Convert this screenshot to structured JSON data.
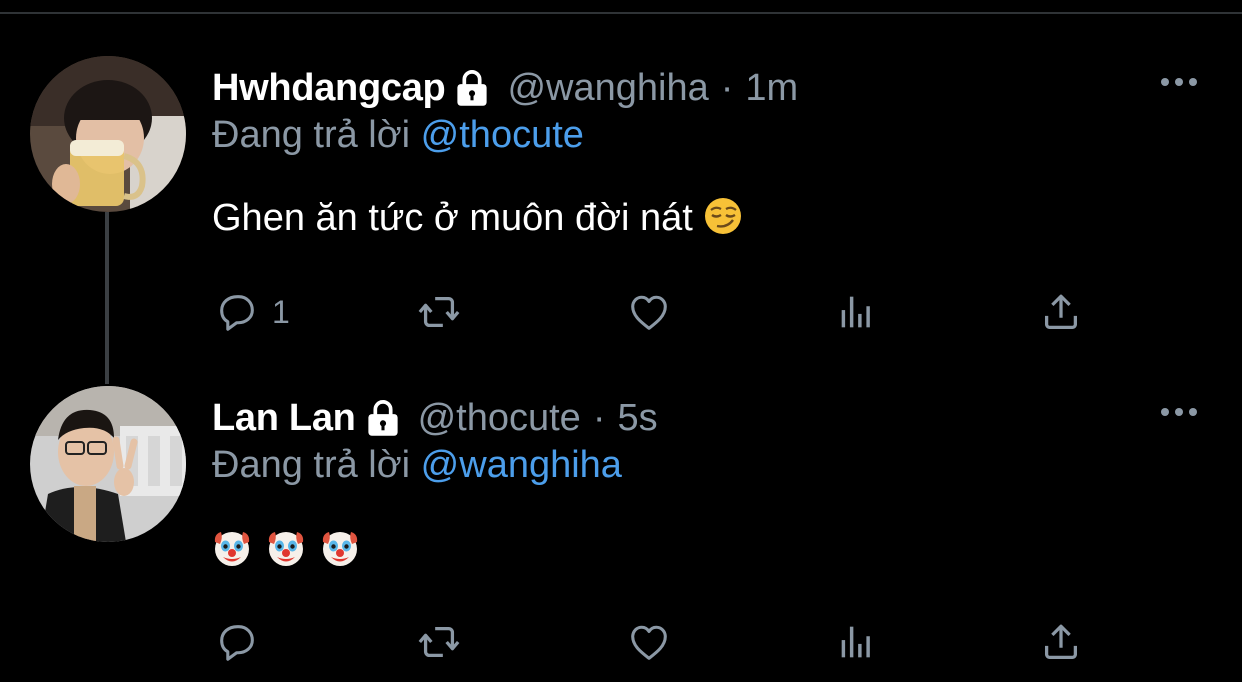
{
  "tweets": [
    {
      "display_name": "Hwhdangcap",
      "handle": "@wanghiha",
      "separator": "·",
      "time": "1m",
      "reply_prefix": "Đang trả lời",
      "reply_mention": "@thocute",
      "text": "Ghen ăn tức ở muôn đời nát",
      "text_emoji": "smirking-face",
      "reply_count": "1",
      "retweet_count": "",
      "like_count": ""
    },
    {
      "display_name": "Lan Lan",
      "handle": "@thocute",
      "separator": "·",
      "time": "5s",
      "reply_prefix": "Đang trả lời",
      "reply_mention": "@wanghiha",
      "text_emojis": [
        "clown-face",
        "clown-face",
        "clown-face"
      ],
      "reply_count": "",
      "retweet_count": "",
      "like_count": ""
    }
  ],
  "icons": {
    "locked": "lock-icon",
    "more": "more-horizontal-icon",
    "reply": "reply-bubble-icon",
    "retweet": "retweet-icon",
    "like": "heart-icon",
    "stats": "analytics-bars-icon",
    "share": "share-upload-icon"
  },
  "colors": {
    "background": "#000000",
    "primary_text": "#ffffff",
    "secondary_text": "#8b98a5",
    "link": "#4c9eeb",
    "thread_line": "#3b3f43"
  }
}
